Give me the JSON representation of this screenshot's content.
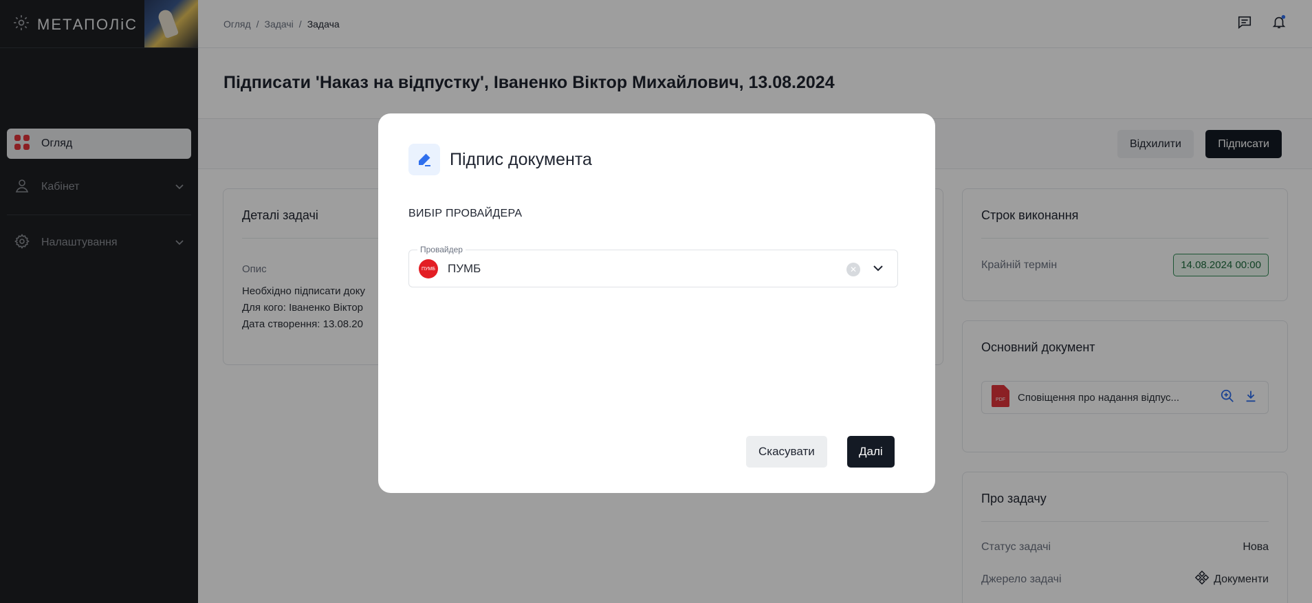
{
  "sidebar": {
    "logo_text": "МЕТАПОЛіС",
    "items": [
      {
        "label": "Огляд",
        "icon": "dashboard-grid-icon",
        "active": true
      },
      {
        "label": "Кабінет",
        "icon": "user-icon"
      },
      {
        "label": "Налаштування",
        "icon": "gear-icon"
      }
    ]
  },
  "breadcrumb": [
    "Огляд",
    "Задачі",
    "Задача"
  ],
  "page": {
    "title": "Підписати 'Наказ на відпустку', Іваненко Віктор Михайлович, 13.08.2024",
    "reject_label": "Відхилити",
    "sign_label": "Підписати"
  },
  "details": {
    "title": "Деталі задачі",
    "desc_label": "Опис",
    "lines": [
      "Необхідно підписати доку",
      "Для кого: Іваненко Віктор",
      "Дата створення: 13.08.20"
    ]
  },
  "deadline": {
    "title": "Строк виконання",
    "label": "Крайній термін",
    "value": "14.08.2024 00:00"
  },
  "main_doc": {
    "title": "Основний документ",
    "file_name": "Сповіщення про надання відпус..."
  },
  "about": {
    "title": "Про задачу",
    "status_label": "Статус задачі",
    "status_value": "Нова",
    "source_label": "Джерело задачі",
    "source_value": "Документи"
  },
  "modal": {
    "title": "Підпис документа",
    "section": "ВИБІР ПРОВАЙДЕРА",
    "provider_label": "Провайдер",
    "provider_value": "ПУМБ",
    "provider_logo_text": "ПУМБ",
    "cancel_label": "Скасувати",
    "next_label": "Далі"
  },
  "colors": {
    "accent": "#141a24",
    "badge_green": "#2f8a55",
    "bank_red": "#e31e24",
    "pen_blue": "#2f6fed"
  }
}
